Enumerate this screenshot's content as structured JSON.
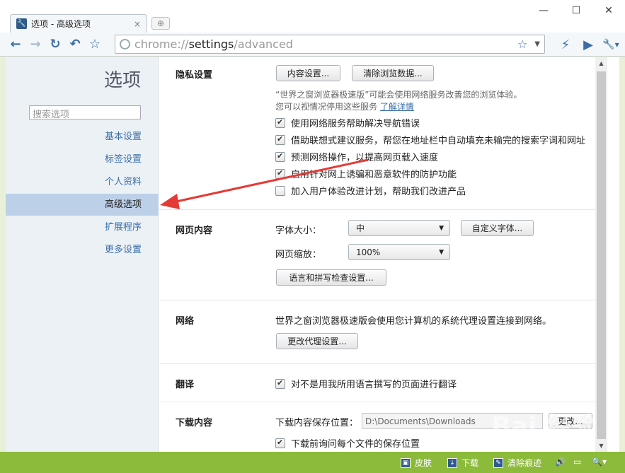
{
  "titlebar": {
    "tab_title": "选项 - 高级选项",
    "tab_close": "×",
    "new_tab": "⊕",
    "minimize": "—",
    "maximize": "☐",
    "close": "✕"
  },
  "toolbar": {
    "back": "←",
    "forward": "→",
    "reload": "↻",
    "undo": "↶",
    "bookmark": "☆",
    "url_scheme": "chrome://",
    "url_host": "settings",
    "url_path": "/advanced",
    "star": "☆",
    "dropdown": "▼",
    "flash": "⚡",
    "play": "▶",
    "wrench": "🔧",
    "wrench_dd": "▼"
  },
  "sidebar": {
    "title": "选项",
    "search_placeholder": "搜索选项",
    "items": [
      {
        "label": "基本设置"
      },
      {
        "label": "标签设置"
      },
      {
        "label": "个人资料"
      },
      {
        "label": "高级选项"
      },
      {
        "label": "扩展程序"
      },
      {
        "label": "更多设置"
      }
    ]
  },
  "privacy": {
    "title": "隐私设置",
    "content_settings_btn": "内容设置...",
    "clear_data_btn": "清除浏览数据...",
    "note_line1": "“世界之窗浏览器极速版”可能会使用网络服务改善您的浏览体验。",
    "note_line2": "您可以视情况停用这些服务",
    "learn_more": "了解详情",
    "options": [
      {
        "label": "使用网络服务帮助解决导航错误",
        "checked": true
      },
      {
        "label": "借助联想式建议服务，帮您在地址栏中自动填充未输完的搜索字词和网址",
        "checked": true
      },
      {
        "label": "预测网络操作，以提高网页载入速度",
        "checked": true
      },
      {
        "label": "启用针对网上诱骗和恶意软件的防护功能",
        "checked": true
      },
      {
        "label": "加入用户体验改进计划，帮助我们改进产品",
        "checked": false
      }
    ]
  },
  "web_content": {
    "title": "网页内容",
    "font_size_label": "字体大小：",
    "font_size_value": "中",
    "custom_fonts_btn": "自定义字体...",
    "zoom_label": "网页缩放：",
    "zoom_value": "100%",
    "lang_btn": "语言和拼写检查设置..."
  },
  "network": {
    "title": "网络",
    "description": "世界之窗浏览器极速版会使用您计算机的系统代理设置连接到网络。",
    "proxy_btn": "更改代理设置..."
  },
  "translate": {
    "title": "翻译",
    "option": "对不是用我所用语言撰写的页面进行翻译",
    "checked": true
  },
  "downloads": {
    "title": "下载内容",
    "location_label": "下载内容保存位置：",
    "location_value": "D:\\Documents\\Downloads",
    "change_btn": "更改...",
    "ask_option": "下载前询问每个文件的保存位置",
    "ask_checked": true
  },
  "statusbar": {
    "skin": "皮肤",
    "download": "下载",
    "clear_traces": "清除痕迹"
  },
  "watermark": {
    "text": "Bai 经验",
    "sub": "jingyan.baidu.com"
  },
  "colors": {
    "accent": "#3a6ea5",
    "sidebar_active": "#bcd0e8",
    "statusbar": "#8cba3a",
    "arrow": "#e53935"
  }
}
